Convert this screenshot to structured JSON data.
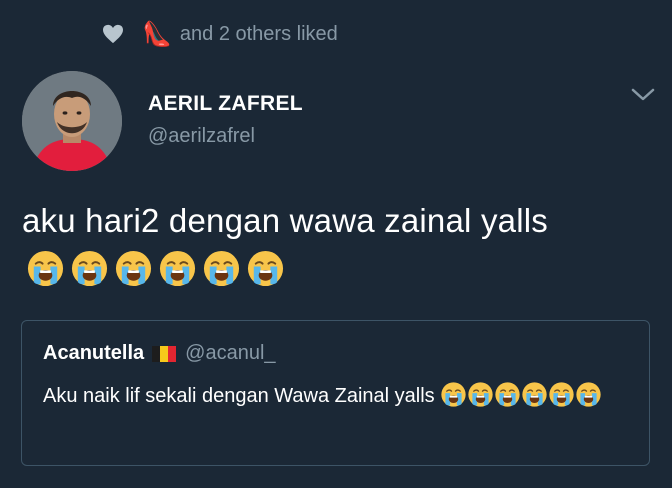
{
  "social_context": {
    "text": "and 2 others liked",
    "heel_emoji": "👠"
  },
  "tweet": {
    "author_name": "AERIL ZAFREL",
    "author_handle": "@aerilzafrel",
    "text": "aku hari2 dengan wawa zainal yalls",
    "emoji_count": 6
  },
  "quoted_tweet": {
    "author_name": "Acanutella",
    "author_handle": "@acanul_",
    "text": "Aku naik lif sekali dengan Wawa Zainal yalls",
    "emoji_count": 6
  },
  "colors": {
    "background": "#1b2836",
    "secondary_text": "#8899a6",
    "border": "#3d5466"
  }
}
